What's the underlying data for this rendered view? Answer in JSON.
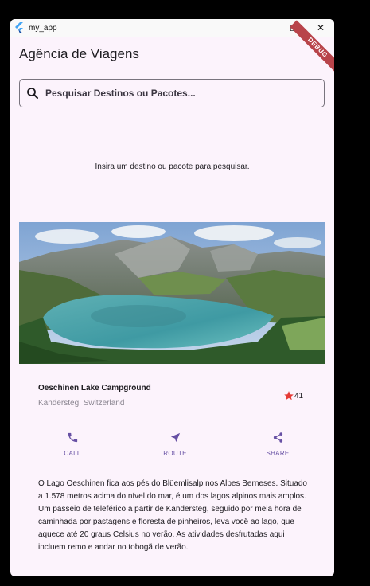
{
  "window": {
    "title": "my_app",
    "controls": {
      "minimize": "–",
      "maximize": "☐",
      "close": "✕"
    }
  },
  "debug_banner": "DEBUG",
  "app_bar": {
    "title": "Agência de Viagens"
  },
  "search": {
    "placeholder": "Pesquisar Destinos ou Pacotes..."
  },
  "empty_state": "Insira um destino ou pacote para pesquisar.",
  "place": {
    "name": "Oeschinen Lake Campground",
    "location": "Kandersteg, Switzerland",
    "rating": "41",
    "actions": [
      {
        "icon": "phone-icon",
        "label": "CALL"
      },
      {
        "icon": "navigation-icon",
        "label": "ROUTE"
      },
      {
        "icon": "share-icon",
        "label": "SHARE"
      }
    ],
    "description": "O Lago Oeschinen fica aos pés do Blüemlisalp nos Alpes Berneses. Situado a 1.578 metros acima do nível do mar, é um dos lagos alpinos mais amplos. Um passeio de teleférico a partir de Kandersteg, seguido por meia hora de caminhada por pastagens e floresta de pinheiros, leva você ao lago, que aquece até 20 graus Celsius no verão. As atividades desfrutadas aqui incluem remo e andar no tobogã de verão."
  },
  "colors": {
    "accent": "#6750a4",
    "background": "#fcf3fc",
    "star": "#e53935",
    "debug": "#b8444a"
  }
}
